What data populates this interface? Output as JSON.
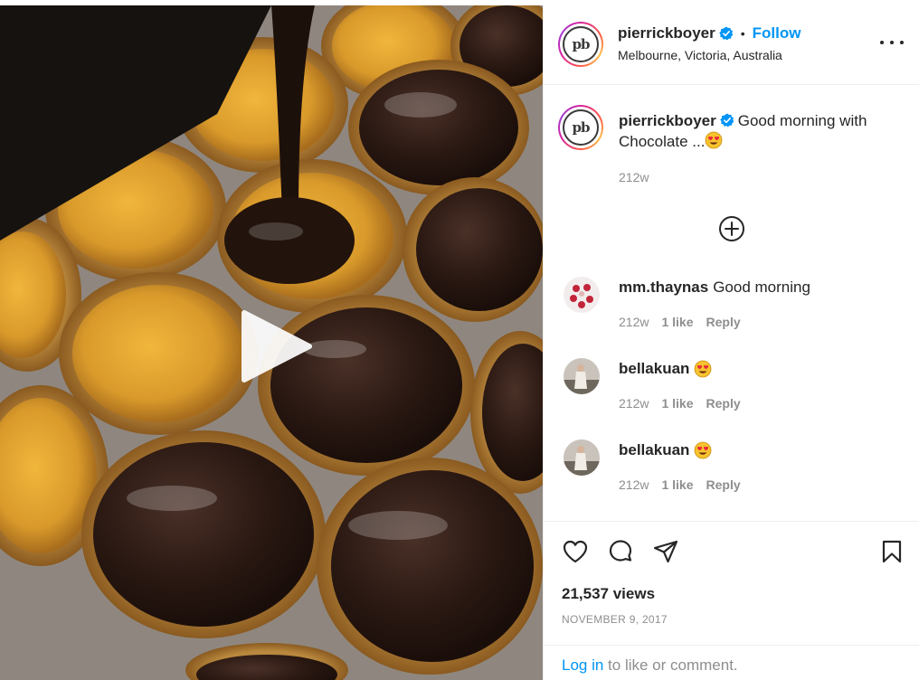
{
  "post": {
    "author": {
      "username": "pierrickboyer",
      "location": "Melbourne, Victoria, Australia",
      "follow_label": "Follow",
      "separator": "•",
      "avatar_text": "pb"
    },
    "caption": {
      "username": "pierrickboyer",
      "text": "Good morning with Chocolate ...",
      "emoji": "heart-eyes-emoji",
      "age": "212w"
    },
    "comments": [
      {
        "username": "mm.thaynas",
        "text": "Good morning",
        "emoji": "",
        "age": "212w",
        "likes": "1 like",
        "reply": "Reply"
      },
      {
        "username": "bellakuan",
        "text": "",
        "emoji": "heart-eyes-emoji",
        "age": "212w",
        "likes": "1 like",
        "reply": "Reply"
      },
      {
        "username": "bellakuan",
        "text": "",
        "emoji": "heart-eyes-emoji",
        "age": "212w",
        "likes": "1 like",
        "reply": "Reply"
      }
    ],
    "stats": {
      "views": "21,537 views",
      "date": "NOVEMBER 9, 2017"
    },
    "login_prompt": {
      "link": "Log in",
      "rest": " to like or comment."
    },
    "icons": {
      "verified": "verified-badge-icon",
      "more": "more-options-icon",
      "load_more": "add-circle-icon",
      "like": "heart-icon",
      "comment": "comment-icon",
      "share": "send-icon",
      "save": "bookmark-icon",
      "play": "play-icon"
    },
    "colors": {
      "link_blue": "#0095f6",
      "verified_blue": "#0095f6",
      "muted": "#8e8e8e",
      "text": "#262626"
    }
  }
}
